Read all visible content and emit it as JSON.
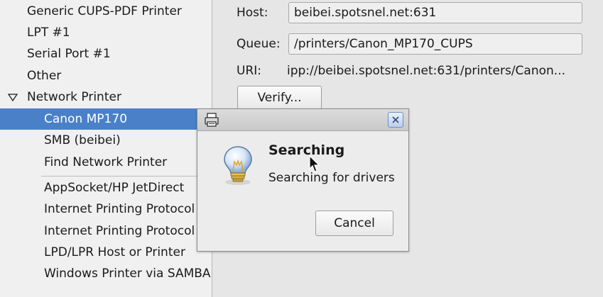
{
  "device_list": {
    "items": [
      {
        "label": "Generic CUPS-PDF Printer"
      },
      {
        "label": "LPT #1"
      },
      {
        "label": "Serial Port #1"
      },
      {
        "label": "Other"
      },
      {
        "label": "Network Printer"
      },
      {
        "label": "Canon MP170"
      },
      {
        "label": "SMB (beibei)"
      },
      {
        "label": "Find Network Printer"
      },
      {
        "label": "AppSocket/HP JetDirect"
      },
      {
        "label": "Internet Printing Protocol"
      },
      {
        "label": "Internet Printing Protocol"
      },
      {
        "label": "LPD/LPR Host or Printer"
      },
      {
        "label": "Windows Printer via SAMBA"
      }
    ],
    "selected": "Canon MP170"
  },
  "settings": {
    "host_label": "Host:",
    "host_value": "beibei.spotsnel.net:631",
    "queue_label": "Queue:",
    "queue_value": "/printers/Canon_MP170_CUPS",
    "uri_label": "URI:",
    "uri_value": "ipp://beibei.spotsnel.net:631/printers/Canon...",
    "verify_label": "Verify..."
  },
  "dialog": {
    "heading": "Searching",
    "message": "Searching for drivers",
    "cancel_label": "Cancel",
    "icon": "lightbulb-icon"
  },
  "colors": {
    "selection": "#4a80c8",
    "close_accent": "#6f8fc0"
  }
}
